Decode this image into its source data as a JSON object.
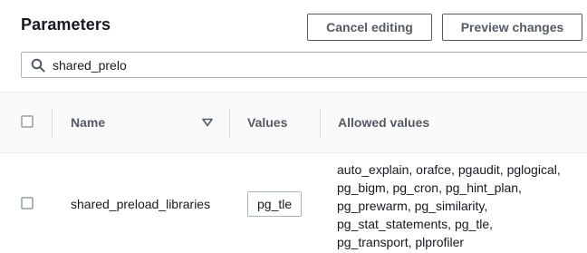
{
  "header": {
    "title": "Parameters",
    "cancel_label": "Cancel editing",
    "preview_label": "Preview changes"
  },
  "search": {
    "value": "shared_prelo",
    "icon": "search-icon"
  },
  "table": {
    "columns": {
      "name": "Name",
      "values": "Values",
      "allowed": "Allowed values"
    },
    "sort_icon": "caret-down-icon",
    "rows": [
      {
        "name": "shared_preload_libraries",
        "value": "pg_tle",
        "allowed_lines": [
          "auto_explain, orafce, pgaudit, pglogical,",
          "pg_bigm, pg_cron, pg_hint_plan,",
          "pg_prewarm, pg_similarity,",
          "pg_stat_statements, pg_tle,",
          "pg_transport, plprofiler"
        ]
      }
    ]
  },
  "colors": {
    "text": "#16191f",
    "secondary": "#545b64",
    "border": "#aab7b8",
    "header_bg": "#fafafa"
  }
}
